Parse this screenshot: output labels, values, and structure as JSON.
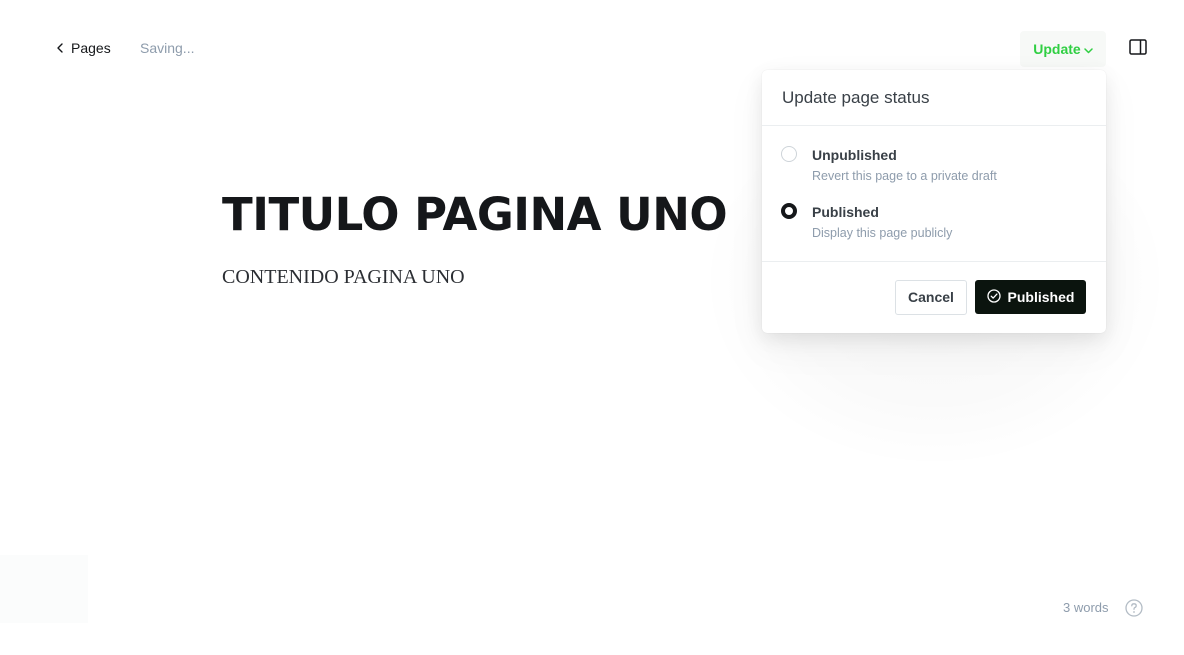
{
  "topbar": {
    "back_label": "Pages",
    "saving_status": "Saving...",
    "update_label": "Update"
  },
  "editor": {
    "title": "TITULO PAGINA UNO",
    "body": "CONTENIDO PAGINA UNO"
  },
  "status_popover": {
    "heading": "Update page status",
    "options": [
      {
        "label": "Unpublished",
        "description": "Revert this page to a private draft",
        "selected": false
      },
      {
        "label": "Published",
        "description": "Display this page publicly",
        "selected": true
      }
    ],
    "cancel_label": "Cancel",
    "confirm_label": "Published"
  },
  "footer": {
    "word_count": "3 words"
  },
  "colors": {
    "accent_green": "#30cf43",
    "primary_dark": "#0b140e",
    "muted_text": "#8e9cac"
  },
  "icons": {
    "back": "chevron-left-icon",
    "update_dropdown": "chevron-down-icon",
    "settings_toggle": "sidebar-panel-icon",
    "confirm": "check-circle-icon",
    "help": "question-circle-icon"
  }
}
